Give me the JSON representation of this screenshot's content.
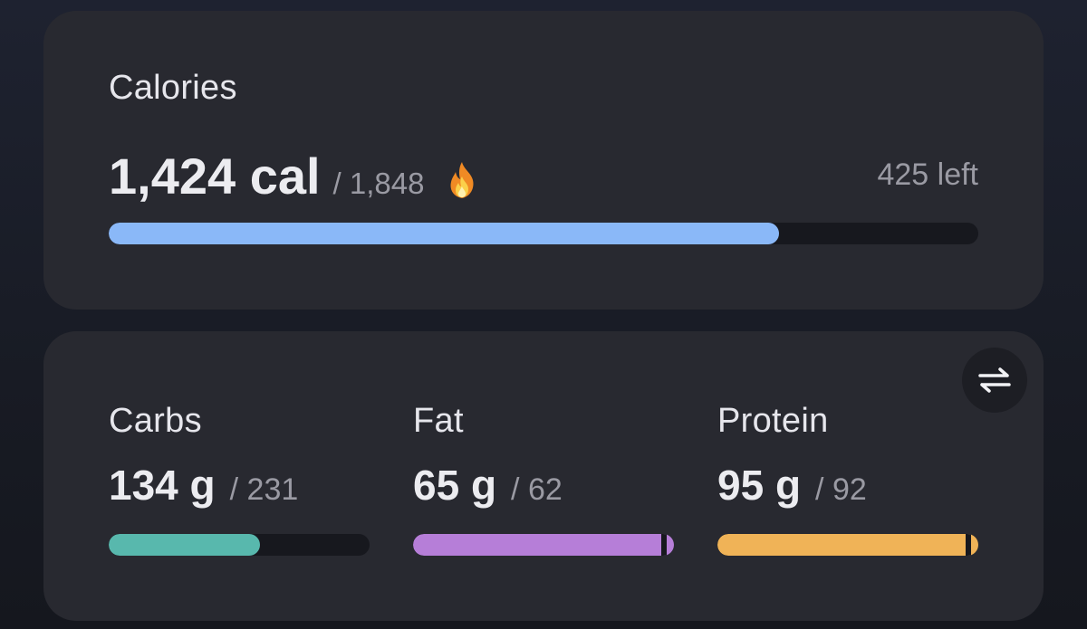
{
  "calories": {
    "title": "Calories",
    "value": "1,424 cal",
    "goal": "/ 1,848",
    "left": "425 left",
    "icon": "fire-icon",
    "progress": 0.771,
    "bar_color": "#8ab8f8"
  },
  "macros": {
    "swap_icon": "swap-arrows-icon",
    "items": [
      {
        "label": "Carbs",
        "value": "134 g",
        "goal": "/ 231",
        "progress": 0.58,
        "color": "#58b8ad"
      },
      {
        "label": "Fat",
        "value": "65 g",
        "goal": "/ 62",
        "progress": 1.0,
        "over": true,
        "color": "#b67ed8"
      },
      {
        "label": "Protein",
        "value": "95 g",
        "goal": "/ 92",
        "progress": 1.0,
        "over": true,
        "color": "#f0b357"
      }
    ]
  }
}
